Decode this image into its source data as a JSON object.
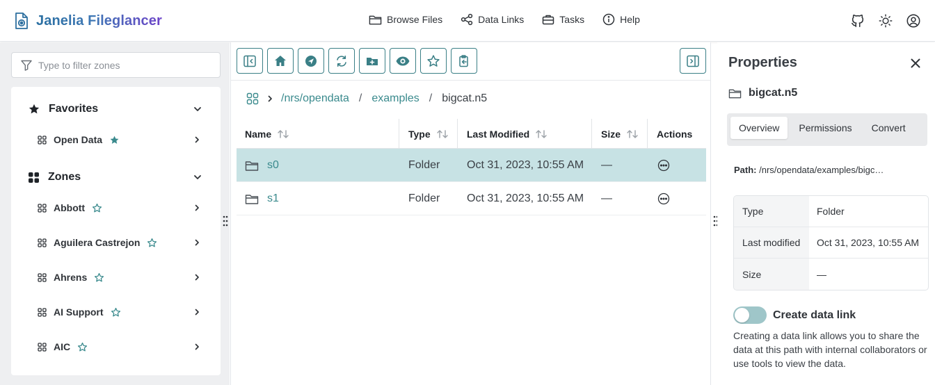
{
  "app": {
    "title": "Janelia Fileglancer"
  },
  "nav": {
    "items": [
      {
        "label": "Browse Files",
        "icon": "folder-icon"
      },
      {
        "label": "Data Links",
        "icon": "share-icon"
      },
      {
        "label": "Tasks",
        "icon": "briefcase-icon"
      },
      {
        "label": "Help",
        "icon": "info-icon"
      }
    ],
    "right_icons": [
      "github-icon",
      "sun-icon",
      "user-circle-icon"
    ]
  },
  "sidebar": {
    "filter_placeholder": "Type to filter zones",
    "favorites": {
      "label": "Favorites",
      "items": [
        {
          "label": "Open Data",
          "starred": true
        }
      ]
    },
    "zones": {
      "label": "Zones",
      "items": [
        {
          "label": "Abbott",
          "starred": false
        },
        {
          "label": "Aguilera Castrejon",
          "starred": false
        },
        {
          "label": "Ahrens",
          "starred": false
        },
        {
          "label": "AI Support",
          "starred": false
        },
        {
          "label": "AIC",
          "starred": false
        }
      ]
    }
  },
  "toolbar": {
    "buttons": [
      "toggle-sidebar-icon",
      "home-icon",
      "navigate-icon",
      "refresh-icon",
      "new-folder-icon",
      "eye-icon",
      "star-icon",
      "clipboard-copy-icon"
    ],
    "right_button": "toggle-properties-icon"
  },
  "breadcrumb": {
    "segments": [
      "/nrs/opendata",
      "examples"
    ],
    "separator": "/",
    "current": "bigcat.n5"
  },
  "file_table": {
    "columns": [
      "Name",
      "Type",
      "Last Modified",
      "Size",
      "Actions"
    ],
    "rows": [
      {
        "name": "s0",
        "type": "Folder",
        "modified": "Oct 31, 2023, 10:55 AM",
        "size": "—",
        "selected": true
      },
      {
        "name": "s1",
        "type": "Folder",
        "modified": "Oct 31, 2023, 10:55 AM",
        "size": "—",
        "selected": false
      }
    ]
  },
  "properties": {
    "title": "Properties",
    "filename": "bigcat.n5",
    "tabs": [
      "Overview",
      "Permissions",
      "Convert"
    ],
    "active_tab": "Overview",
    "path_label": "Path:",
    "path_value": "/nrs/opendata/examples/bigc…",
    "info": [
      {
        "key": "Type",
        "value": "Folder"
      },
      {
        "key": "Last modified",
        "value": "Oct 31, 2023, 10:55 AM"
      },
      {
        "key": "Size",
        "value": "—"
      }
    ],
    "data_link": {
      "label": "Create data link",
      "enabled": false,
      "description": "Creating a data link allows you to share the data at this path with internal collaborators or use tools to view the data."
    }
  },
  "colors": {
    "accent": "#3a8a8d",
    "selected_row": "#c7e2e4",
    "toolbar_border": "#3a7f86",
    "toggle_off": "#9fc6c9"
  }
}
